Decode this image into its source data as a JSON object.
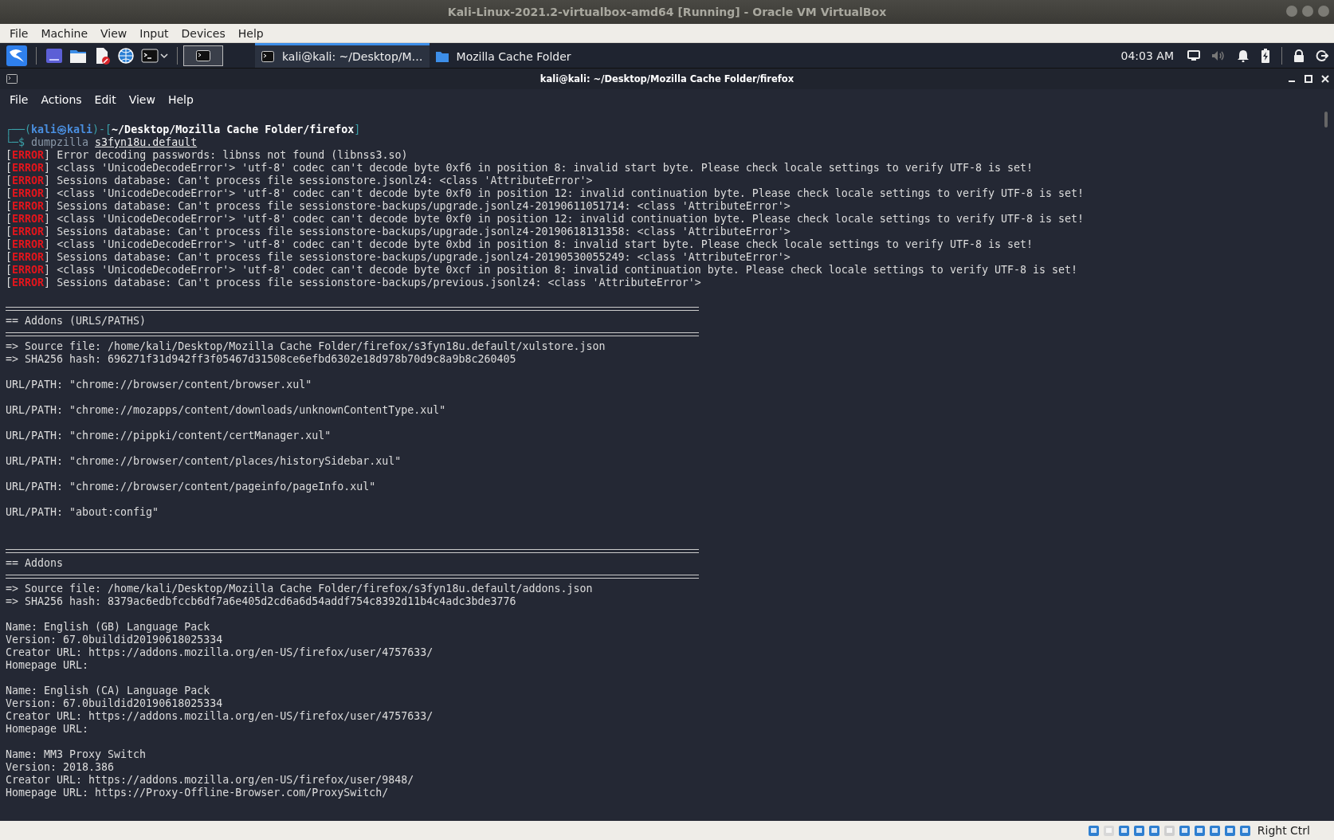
{
  "window": {
    "title": "Kali-Linux-2021.2-virtualbox-amd64 [Running] - Oracle VM VirtualBox"
  },
  "vm_menu": [
    "File",
    "Machine",
    "View",
    "Input",
    "Devices",
    "Help"
  ],
  "panel": {
    "tasks": [
      {
        "label": "kali@kali: ~/Desktop/M…",
        "kind": "terminal",
        "selected": true
      },
      {
        "label": "Mozilla Cache Folder",
        "kind": "folder",
        "selected": false
      }
    ],
    "clock": "04:03 AM"
  },
  "terminal": {
    "title": "kali@kali: ~/Desktop/Mozilla Cache Folder/firefox",
    "menu": [
      "File",
      "Actions",
      "Edit",
      "View",
      "Help"
    ],
    "lines": [
      {
        "kind": "prompt",
        "segments": [
          "┌──(",
          "kali㉿kali",
          ")-[",
          "~/Desktop/Mozilla Cache Folder/firefox",
          "]"
        ]
      },
      {
        "kind": "command",
        "segments": [
          "└─$ ",
          "dumpzilla ",
          "s3fyn18u.default"
        ]
      },
      {
        "kind": "error",
        "tag": "[ERROR]",
        "text": "Error decoding passwords: libnss not found (libnss3.so)"
      },
      {
        "kind": "error",
        "tag": "[ERROR]",
        "text": "<class 'UnicodeDecodeError'> 'utf-8' codec can't decode byte 0xf6 in position 8: invalid start byte. Please check locale settings to verify UTF-8 is set!"
      },
      {
        "kind": "error",
        "tag": "[ERROR]",
        "text": "Sessions database: Can't process file sessionstore.jsonlz4: <class 'AttributeError'>"
      },
      {
        "kind": "error",
        "tag": "[ERROR]",
        "text": "<class 'UnicodeDecodeError'> 'utf-8' codec can't decode byte 0xf0 in position 12: invalid continuation byte. Please check locale settings to verify UTF-8 is set!"
      },
      {
        "kind": "error",
        "tag": "[ERROR]",
        "text": "Sessions database: Can't process file sessionstore-backups/upgrade.jsonlz4-20190611051714: <class 'AttributeError'>"
      },
      {
        "kind": "error",
        "tag": "[ERROR]",
        "text": "<class 'UnicodeDecodeError'> 'utf-8' codec can't decode byte 0xf0 in position 12: invalid continuation byte. Please check locale settings to verify UTF-8 is set!"
      },
      {
        "kind": "error",
        "tag": "[ERROR]",
        "text": "Sessions database: Can't process file sessionstore-backups/upgrade.jsonlz4-20190618131358: <class 'AttributeError'>"
      },
      {
        "kind": "error",
        "tag": "[ERROR]",
        "text": "<class 'UnicodeDecodeError'> 'utf-8' codec can't decode byte 0xbd in position 8: invalid start byte. Please check locale settings to verify UTF-8 is set!"
      },
      {
        "kind": "error",
        "tag": "[ERROR]",
        "text": "Sessions database: Can't process file sessionstore-backups/upgrade.jsonlz4-20190530055249: <class 'AttributeError'>"
      },
      {
        "kind": "error",
        "tag": "[ERROR]",
        "text": "<class 'UnicodeDecodeError'> 'utf-8' codec can't decode byte 0xcf in position 8: invalid continuation byte. Please check locale settings to verify UTF-8 is set!"
      },
      {
        "kind": "error",
        "tag": "[ERROR]",
        "text": "Sessions database: Can't process file sessionstore-backups/previous.jsonlz4: <class 'AttributeError'>"
      },
      {
        "kind": "blank"
      },
      {
        "kind": "rule"
      },
      {
        "kind": "heading",
        "text": "== Addons (URLS/PATHS)"
      },
      {
        "kind": "rule"
      },
      {
        "kind": "output",
        "text": "=> Source file: /home/kali/Desktop/Mozilla Cache Folder/firefox/s3fyn18u.default/xulstore.json"
      },
      {
        "kind": "output",
        "text": "=> SHA256 hash: 696271f31d942ff3f05467d31508ce6efbd6302e18d978b70d9c8a9b8c260405"
      },
      {
        "kind": "blank"
      },
      {
        "kind": "output",
        "text": "URL/PATH: \"chrome://browser/content/browser.xul\""
      },
      {
        "kind": "blank"
      },
      {
        "kind": "output",
        "text": "URL/PATH: \"chrome://mozapps/content/downloads/unknownContentType.xul\""
      },
      {
        "kind": "blank"
      },
      {
        "kind": "output",
        "text": "URL/PATH: \"chrome://pippki/content/certManager.xul\""
      },
      {
        "kind": "blank"
      },
      {
        "kind": "output",
        "text": "URL/PATH: \"chrome://browser/content/places/historySidebar.xul\""
      },
      {
        "kind": "blank"
      },
      {
        "kind": "output",
        "text": "URL/PATH: \"chrome://browser/content/pageinfo/pageInfo.xul\""
      },
      {
        "kind": "blank"
      },
      {
        "kind": "output",
        "text": "URL/PATH: \"about:config\""
      },
      {
        "kind": "blank"
      },
      {
        "kind": "blank"
      },
      {
        "kind": "rule"
      },
      {
        "kind": "heading",
        "text": "== Addons"
      },
      {
        "kind": "rule"
      },
      {
        "kind": "output",
        "text": "=> Source file: /home/kali/Desktop/Mozilla Cache Folder/firefox/s3fyn18u.default/addons.json"
      },
      {
        "kind": "output",
        "text": "=> SHA256 hash: 8379ac6edbfccb6df7a6e405d2cd6a6d54addf754c8392d11b4c4adc3bde3776"
      },
      {
        "kind": "blank"
      },
      {
        "kind": "output",
        "text": "Name: English (GB) Language Pack"
      },
      {
        "kind": "output",
        "text": "Version: 67.0buildid20190618025334"
      },
      {
        "kind": "output",
        "text": "Creator URL: https://addons.mozilla.org/en-US/firefox/user/4757633/"
      },
      {
        "kind": "output",
        "text": "Homepage URL:"
      },
      {
        "kind": "blank"
      },
      {
        "kind": "output",
        "text": "Name: English (CA) Language Pack"
      },
      {
        "kind": "output",
        "text": "Version: 67.0buildid20190618025334"
      },
      {
        "kind": "output",
        "text": "Creator URL: https://addons.mozilla.org/en-US/firefox/user/4757633/"
      },
      {
        "kind": "output",
        "text": "Homepage URL:"
      },
      {
        "kind": "blank"
      },
      {
        "kind": "output",
        "text": "Name: MM3 Proxy Switch"
      },
      {
        "kind": "output",
        "text": "Version: 2018.386"
      },
      {
        "kind": "output",
        "text": "Creator URL: https://addons.mozilla.org/en-US/firefox/user/9848/"
      },
      {
        "kind": "output",
        "text": "Homepage URL: https://Proxy-Offline-Browser.com/ProxySwitch/"
      }
    ]
  },
  "status_bar": {
    "host_key": "Right Ctrl"
  }
}
